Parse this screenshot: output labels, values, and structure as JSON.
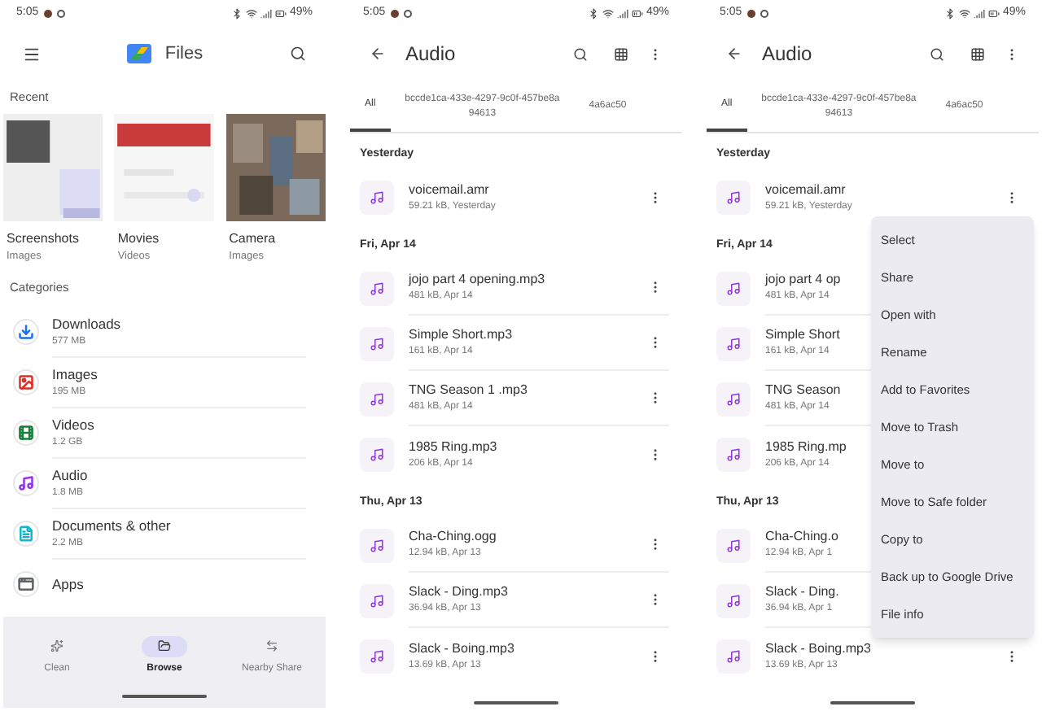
{
  "files_home": {
    "status": {
      "time": "5:05",
      "battery": "49%"
    },
    "app_bar": {
      "title": "Files"
    },
    "recent": {
      "heading": "Recent",
      "items": [
        {
          "name": "Screenshots",
          "type": "Images"
        },
        {
          "name": "Movies",
          "type": "Videos"
        },
        {
          "name": "Camera",
          "type": "Images"
        }
      ]
    },
    "categories": {
      "heading": "Categories",
      "items": [
        {
          "kind": "downloads",
          "name": "Downloads",
          "size": "577 MB",
          "color": "#1a73e8"
        },
        {
          "kind": "images",
          "name": "Images",
          "size": "195 MB",
          "color": "#d93025"
        },
        {
          "kind": "videos",
          "name": "Videos",
          "size": "1.2 GB",
          "color": "#188038"
        },
        {
          "kind": "audio",
          "name": "Audio",
          "size": "1.8 MB",
          "color": "#9334e6"
        },
        {
          "kind": "documents",
          "name": "Documents & other",
          "size": "2.2 MB",
          "color": "#12b5cb"
        },
        {
          "kind": "apps",
          "name": "Apps",
          "color": "#5f6368"
        }
      ]
    },
    "nav": [
      {
        "kind": "clean",
        "label": "Clean",
        "selected": false
      },
      {
        "kind": "browse",
        "label": "Browse",
        "selected": true
      },
      {
        "kind": "share",
        "label": "Nearby Share",
        "selected": false
      }
    ]
  },
  "audio_list": {
    "status": {
      "time": "5:05",
      "battery": "49%"
    },
    "title": "Audio",
    "tabs": [
      {
        "label": "All",
        "selected": true
      },
      {
        "label": "bccde1ca-433e-4297-9c0f-457be8a",
        "label_line_2": "94613",
        "selected": false
      },
      {
        "label": "4a6ac50",
        "selected": false
      }
    ],
    "sections": [
      {
        "heading": "Yesterday",
        "files": [
          {
            "name": "voicemail.amr",
            "meta": "59.21 kB, Yesterday",
            "more": true
          }
        ]
      },
      {
        "heading": "Fri, Apr 14",
        "files": [
          {
            "name": "jojo part 4 opening.mp3",
            "meta": "481 kB, Apr 14",
            "more": true
          },
          {
            "name": "Simple Short.mp3",
            "meta": "161 kB, Apr 14",
            "more": true
          },
          {
            "name": "TNG Season 1 .mp3",
            "meta": "481 kB, Apr 14",
            "more": true
          },
          {
            "name": "1985 Ring.mp3",
            "meta": "206 kB, Apr 14",
            "more": true
          }
        ]
      },
      {
        "heading": "Thu, Apr 13",
        "files": [
          {
            "name": "Cha-Ching.ogg",
            "meta": "12.94 kB, Apr 13",
            "more": true
          },
          {
            "name": "Slack - Ding.mp3",
            "meta": "36.94 kB, Apr 13",
            "more": true
          },
          {
            "name": "Slack - Boing.mp3",
            "meta": "13.69 kB, Apr 13",
            "more": true
          }
        ]
      }
    ]
  },
  "audio_list_menu": {
    "status": {
      "time": "5:05",
      "battery": "49%"
    },
    "title": "Audio",
    "tabs": [
      {
        "label": "All",
        "selected": true
      },
      {
        "label": "bccde1ca-433e-4297-9c0f-457be8a",
        "label_line_2": "94613",
        "selected": false
      },
      {
        "label": "4a6ac50",
        "selected": false
      }
    ],
    "sections": [
      {
        "heading": "Yesterday",
        "files": [
          {
            "name": "voicemail.amr",
            "meta": "59.21 kB, Yesterday",
            "more": true
          }
        ]
      },
      {
        "heading": "Fri, Apr 14",
        "files": [
          {
            "name": "jojo part 4 op",
            "meta": "481 kB, Apr 14"
          },
          {
            "name": "Simple Short",
            "meta": "161 kB, Apr 14"
          },
          {
            "name": "TNG Season",
            "meta": "481 kB, Apr 14"
          },
          {
            "name": "1985 Ring.mp",
            "meta": "206 kB, Apr 14"
          }
        ]
      },
      {
        "heading": "Thu, Apr 13",
        "files": [
          {
            "name": "Cha-Ching.o",
            "meta": "12.94 kB, Apr 1"
          },
          {
            "name": "Slack - Ding.",
            "meta": "36.94 kB, Apr 1"
          },
          {
            "name": "Slack - Boing.mp3",
            "meta": "13.69 kB, Apr 13",
            "more": true
          }
        ]
      }
    ],
    "menu": [
      "Select",
      "Share",
      "Open with",
      "Rename",
      "Add to Favorites",
      "Move to Trash",
      "Move to",
      "Move to Safe folder",
      "Copy to",
      "Back up to Google Drive",
      "File info"
    ]
  }
}
